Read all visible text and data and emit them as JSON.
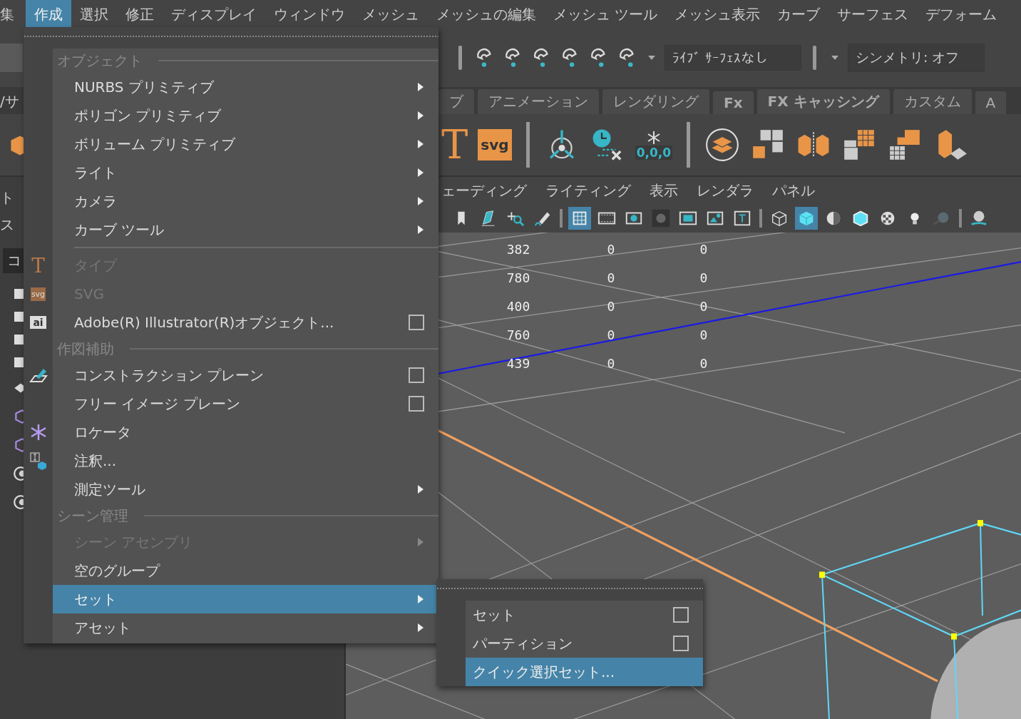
{
  "menubar": [
    {
      "label": "集",
      "selected": false
    },
    {
      "label": "作成",
      "selected": true
    },
    {
      "label": "選択",
      "selected": false
    },
    {
      "label": "修正",
      "selected": false
    },
    {
      "label": "ディスプレイ",
      "selected": false
    },
    {
      "label": "ウィンドウ",
      "selected": false
    },
    {
      "label": "メッシュ",
      "selected": false
    },
    {
      "label": "メッシュの編集",
      "selected": false
    },
    {
      "label": "メッシュ ツール",
      "selected": false
    },
    {
      "label": "メッシュ表示",
      "selected": false
    },
    {
      "label": "カーブ",
      "selected": false
    },
    {
      "label": "サーフェス",
      "selected": false
    },
    {
      "label": "デフォーム",
      "selected": false
    }
  ],
  "status_line": {
    "live_surface": "ﾗｲﾌﾞ ｻｰﾌｪｽなし",
    "symmetry": "シンメトリ: オフ"
  },
  "shelf_tabs": [
    "ブ",
    "アニメーション",
    "レンダリング",
    "Fx",
    "FX キャッシング",
    "カスタム",
    "A"
  ],
  "shelf": {
    "type_glyph": "T",
    "svg_label": "svg",
    "freeze_label": "0,0,0"
  },
  "left_panel": {
    "tab_fragment": "/サ",
    "labels": [
      "ト",
      "ス"
    ],
    "field_fragment": "コ"
  },
  "panel_menu": [
    "ェーディング",
    "ライティング",
    "表示",
    "レンダラ",
    "パネル"
  ],
  "panel_toolbar": [
    {
      "kind": "bookmark",
      "selected": false
    },
    {
      "kind": "plane",
      "selected": false
    },
    {
      "kind": "move",
      "selected": false
    },
    {
      "kind": "pen",
      "selected": false
    },
    {
      "kind": "sep"
    },
    {
      "kind": "grid",
      "selected": true
    },
    {
      "kind": "film",
      "selected": false
    },
    {
      "kind": "gate",
      "selected": false
    },
    {
      "kind": "dark",
      "selected": false
    },
    {
      "kind": "frame",
      "selected": false
    },
    {
      "kind": "image",
      "selected": false
    },
    {
      "kind": "text",
      "selected": false
    },
    {
      "kind": "sep"
    },
    {
      "kind": "wire",
      "selected": false
    },
    {
      "kind": "shaded",
      "selected": true
    },
    {
      "kind": "half",
      "selected": false
    },
    {
      "kind": "wireshaded",
      "selected": false
    },
    {
      "kind": "checker",
      "selected": false
    },
    {
      "kind": "bulb",
      "selected": false
    },
    {
      "kind": "shadow",
      "selected": false
    },
    {
      "kind": "sep"
    },
    {
      "kind": "ball",
      "selected": false
    }
  ],
  "hud_rows": [
    [
      "382",
      "0",
      "0"
    ],
    [
      "780",
      "0",
      "0"
    ],
    [
      "400",
      "0",
      "0"
    ],
    [
      "760",
      "0",
      "0"
    ],
    [
      "439",
      "0",
      "0"
    ]
  ],
  "create_menu": {
    "sections": [
      {
        "title": "オブジェクト",
        "items": [
          {
            "label": "NURBS プリミティブ",
            "kind": "submenu",
            "disabled": false,
            "selected": false
          },
          {
            "label": "ポリゴン プリミティブ",
            "kind": "submenu",
            "disabled": false,
            "selected": false
          },
          {
            "label": "ボリューム プリミティブ",
            "kind": "submenu",
            "disabled": false,
            "selected": false
          },
          {
            "label": "ライト",
            "kind": "submenu",
            "disabled": false,
            "selected": false
          },
          {
            "label": "カメラ",
            "kind": "submenu",
            "disabled": false,
            "selected": false
          },
          {
            "label": "カーブ ツール",
            "kind": "submenu",
            "disabled": false,
            "selected": false
          }
        ]
      },
      {
        "items": [
          {
            "label": "タイプ",
            "kind": "plain",
            "disabled": true,
            "selected": false,
            "icon": {
              "kind": "type",
              "text": "T"
            }
          },
          {
            "label": "SVG",
            "kind": "plain",
            "disabled": true,
            "selected": false,
            "icon": {
              "kind": "svg",
              "text": "svg"
            }
          },
          {
            "label": "Adobe(R) Illustrator(R)オブジェクト...",
            "kind": "option",
            "disabled": false,
            "selected": false,
            "icon": {
              "kind": "ai",
              "text": "ai"
            }
          }
        ]
      },
      {
        "title": "作図補助",
        "items": [
          {
            "label": "コンストラクション プレーン",
            "kind": "option",
            "disabled": false,
            "selected": false,
            "icon": {
              "kind": "plane"
            }
          },
          {
            "label": "フリー イメージ プレーン",
            "kind": "option",
            "disabled": false,
            "selected": false
          },
          {
            "label": "ロケータ",
            "kind": "plain",
            "disabled": false,
            "selected": false,
            "icon": {
              "kind": "locator"
            }
          },
          {
            "label": "注釈...",
            "kind": "plain",
            "disabled": false,
            "selected": false,
            "icon": {
              "kind": "annotation"
            }
          },
          {
            "label": "測定ツール",
            "kind": "submenu",
            "disabled": false,
            "selected": false
          }
        ]
      },
      {
        "title": "シーン管理",
        "items": [
          {
            "label": "シーン アセンブリ",
            "kind": "submenu",
            "disabled": true,
            "selected": false
          },
          {
            "label": "空のグループ",
            "kind": "plain",
            "disabled": false,
            "selected": false
          },
          {
            "label": "セット",
            "kind": "submenu",
            "disabled": false,
            "selected": true
          },
          {
            "label": "アセット",
            "kind": "submenu",
            "disabled": false,
            "selected": false
          }
        ]
      }
    ]
  },
  "set_submenu": [
    {
      "label": "セット",
      "kind": "option",
      "selected": false
    },
    {
      "label": "パーティション",
      "kind": "option",
      "selected": false
    },
    {
      "label": "クイック選択セット...",
      "kind": "plain",
      "selected": true
    }
  ]
}
